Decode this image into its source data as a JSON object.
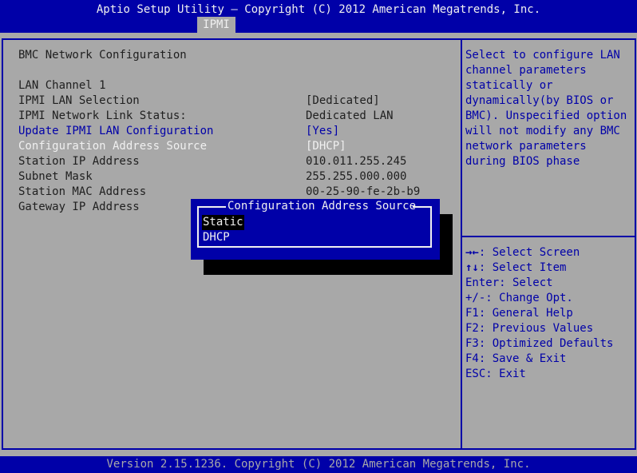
{
  "header": {
    "title": "Aptio Setup Utility – Copyright (C) 2012 American Megatrends, Inc.",
    "active_tab": "IPMI"
  },
  "footer": {
    "text": "Version 2.15.1236. Copyright (C) 2012 American Megatrends, Inc."
  },
  "colors": {
    "background": "#a8a8a8",
    "frame_blue": "#0000a8",
    "text_dark": "#202020",
    "text_white": "#f0f0f0",
    "highlight_black": "#000000"
  },
  "main": {
    "section_title": "BMC Network Configuration",
    "channel_label": "LAN Channel 1",
    "rows": [
      {
        "label": "IPMI LAN Selection",
        "value": "[Dedicated]",
        "interactive": false
      },
      {
        "label": "IPMI Network Link Status:",
        "value": "Dedicated LAN",
        "interactive": false
      },
      {
        "label": "Update IPMI LAN Configuration",
        "value": "[Yes]",
        "interactive": true
      },
      {
        "label": "Configuration Address Source",
        "value": "[DHCP]",
        "interactive": true
      },
      {
        "label": "Station IP Address",
        "value": "010.011.255.245",
        "interactive": false
      },
      {
        "label": "Subnet Mask",
        "value": "255.255.000.000",
        "interactive": false
      },
      {
        "label": "Station MAC Address",
        "value": "00-25-90-fe-2b-b9",
        "interactive": false
      },
      {
        "label": "Gateway IP Address",
        "value": "",
        "interactive": false
      }
    ]
  },
  "help": {
    "description_lines": [
      "Select to configure LAN",
      "channel parameters",
      "statically or",
      "dynamically(by BIOS or",
      "BMC). Unspecified option",
      "will not modify any BMC",
      "network parameters",
      "during BIOS phase"
    ],
    "keys": [
      {
        "icon": "left-right-arrows-icon",
        "glyph": "→←",
        "text": ": Select Screen"
      },
      {
        "icon": "up-down-arrows-icon",
        "glyph": "↑↓",
        "text": ": Select Item"
      },
      {
        "text": "Enter: Select"
      },
      {
        "text": "+/-: Change Opt."
      },
      {
        "text": "F1: General Help"
      },
      {
        "text": "F2: Previous Values"
      },
      {
        "text": "F3: Optimized Defaults"
      },
      {
        "text": "F4: Save & Exit"
      },
      {
        "text": "ESC: Exit"
      }
    ]
  },
  "popup": {
    "title": "Configuration Address Source",
    "options": [
      "Static",
      "DHCP"
    ],
    "selected": "Static"
  }
}
